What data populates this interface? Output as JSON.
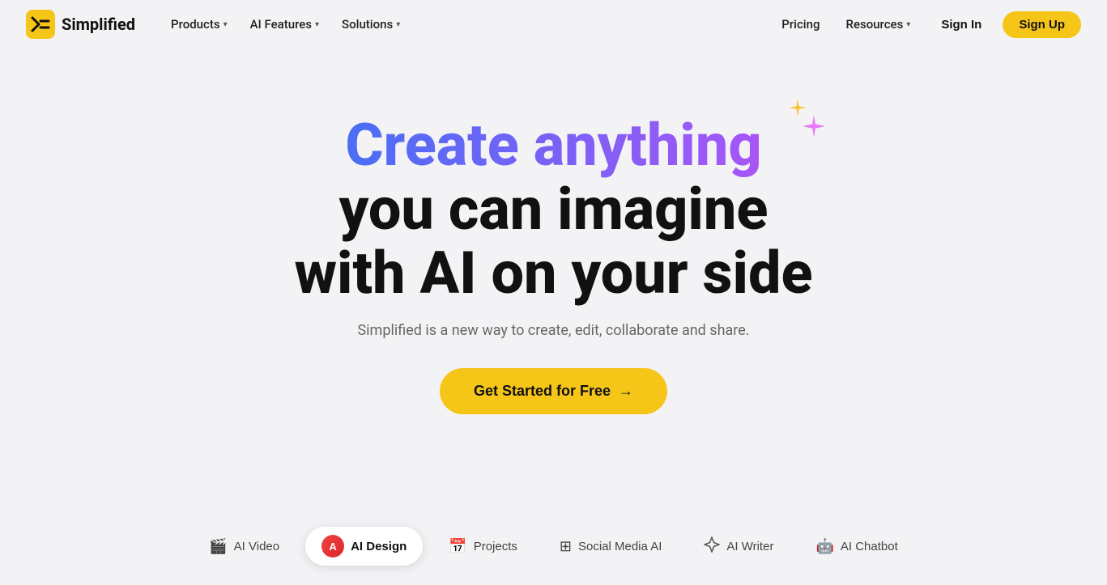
{
  "brand": {
    "name": "Simplified",
    "logo_alt": "Simplified logo"
  },
  "nav": {
    "left_items": [
      {
        "label": "Products",
        "has_dropdown": true
      },
      {
        "label": "AI Features",
        "has_dropdown": true
      },
      {
        "label": "Solutions",
        "has_dropdown": true
      }
    ],
    "right_items": [
      {
        "label": "Pricing",
        "has_dropdown": false
      },
      {
        "label": "Resources",
        "has_dropdown": true
      }
    ],
    "signin_label": "Sign In",
    "signup_label": "Sign Up"
  },
  "hero": {
    "title_gradient": "Create anything",
    "title_line2": "you can imagine",
    "title_line3": "with AI on your side",
    "subtitle": "Simplified is a new way to create, edit, collaborate and share.",
    "cta_label": "Get Started for Free"
  },
  "tabs": [
    {
      "id": "ai-video",
      "label": "AI Video",
      "icon": "🎬",
      "active": false
    },
    {
      "id": "ai-design",
      "label": "AI Design",
      "icon": "design",
      "active": true
    },
    {
      "id": "projects",
      "label": "Projects",
      "icon": "📅",
      "active": false
    },
    {
      "id": "social-media-ai",
      "label": "Social Media AI",
      "icon": "⊞",
      "active": false
    },
    {
      "id": "ai-writer",
      "label": "AI Writer",
      "icon": "⬡",
      "active": false
    },
    {
      "id": "ai-chatbot",
      "label": "AI Chatbot",
      "icon": "🤖",
      "active": false
    }
  ],
  "colors": {
    "accent_yellow": "#f5c518",
    "gradient_start": "#4a6ef5",
    "gradient_end": "#a855f7",
    "sparkle_pink": "#e879f9",
    "sparkle_yellow": "#fbbf24",
    "bg": "#f3f3f6"
  }
}
